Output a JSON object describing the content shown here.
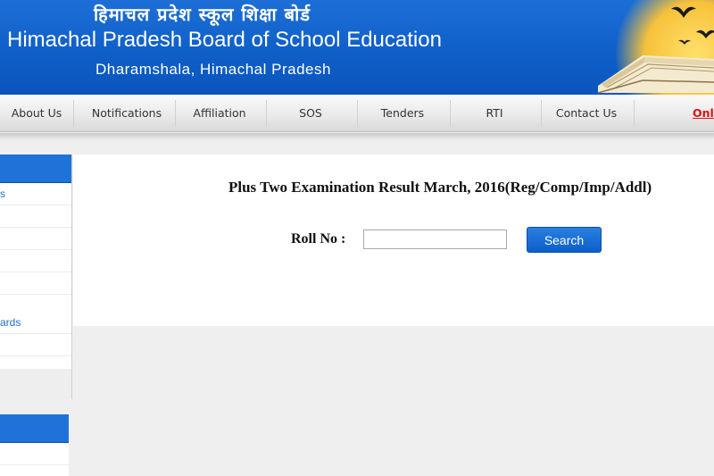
{
  "header": {
    "title_hindi": "हिमाचल प्रदेश स्कूल शिक्षा बोर्ड",
    "title_english": "Himachal Pradesh Board of School Education",
    "location": "Dharamshala, Himachal Pradesh"
  },
  "nav": {
    "items": [
      {
        "label": "About Us"
      },
      {
        "label": "Notifications"
      },
      {
        "label": "Affiliation"
      },
      {
        "label": "SOS"
      },
      {
        "label": "Tenders"
      },
      {
        "label": "RTI"
      },
      {
        "label": "Contact Us"
      }
    ],
    "online_label": "Onli"
  },
  "sidebar": {
    "rows": [
      "s",
      "",
      "",
      "",
      "",
      "ards",
      ""
    ]
  },
  "main": {
    "title": "Plus Two Examination Result March, 2016(Reg/Comp/Imp/Addl)",
    "roll_label": "Roll No :",
    "roll_value": "",
    "search_label": "Search"
  },
  "colors": {
    "header_blue": "#0f5fc8",
    "accent_blue": "#1e72d8",
    "online_red": "#e01010"
  }
}
